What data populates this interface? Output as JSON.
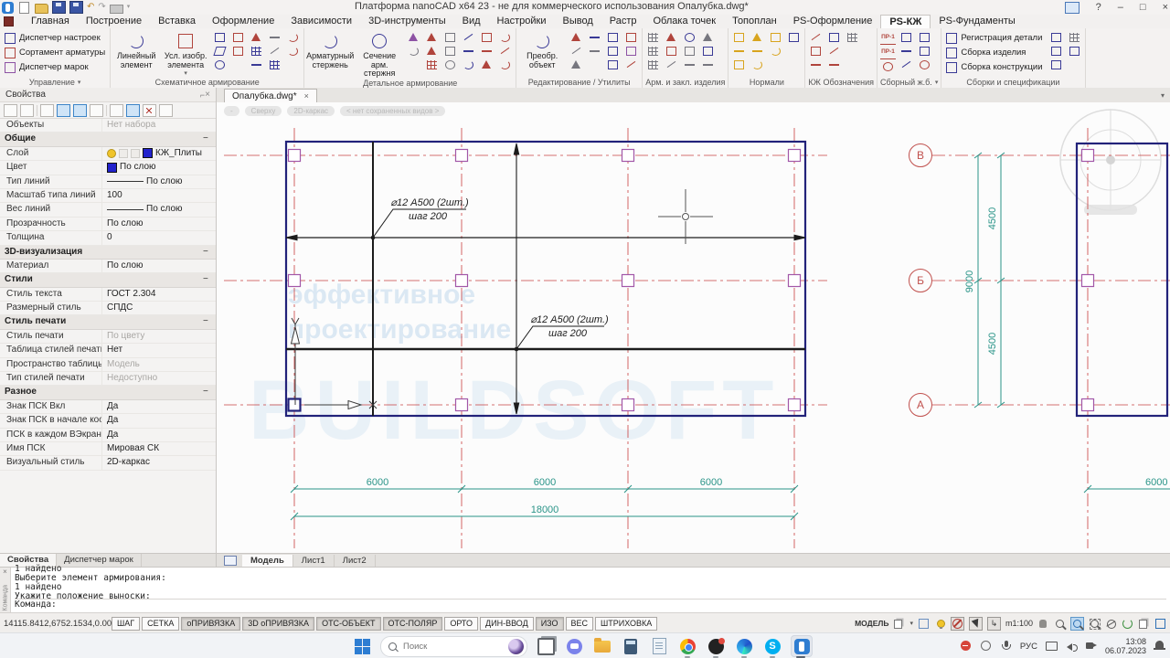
{
  "icons": {
    "close": "×",
    "dropdown": "▾",
    "help": "?",
    "minimize": "–",
    "maximize": "□",
    "undo": "↶",
    "redo": "↷",
    "collapse": "−",
    "more": "▾",
    "ucs": "↳"
  },
  "window": {
    "title": "Платформа nanoCAD x64 23 - не для коммерческого использования Опалубка.dwg*"
  },
  "menu": {
    "tabs": [
      "Главная",
      "Построение",
      "Вставка",
      "Оформление",
      "Зависимости",
      "3D-инструменты",
      "Вид",
      "Настройки",
      "Вывод",
      "Растр",
      "Облака точек",
      "Топоплан",
      "PS-Оформление",
      "PS-КЖ",
      "PS-Фундаменты"
    ],
    "active": "PS-КЖ"
  },
  "ribbon": {
    "groups": [
      {
        "label": "Управление",
        "arrow": true,
        "stack": [
          "Диспетчер настроек",
          "Сортамент арматуры",
          "Диспетчер марок"
        ],
        "stack_icons": [
          "n",
          "r",
          "v"
        ]
      },
      {
        "label": "Схематичное армирование",
        "big": [
          {
            "t": "Линейный элемент",
            "icon": "n-arc"
          },
          {
            "t": "Усл. изобр. элемента",
            "icon": "r-rect",
            "arrow": true
          }
        ],
        "cols": [
          [
            "n-rect",
            "n-para",
            "n-circ"
          ],
          [
            "r-rect",
            "r-rect"
          ],
          [
            "r-tri",
            "n-grid",
            "n-line"
          ],
          [
            "g-line",
            "g-diag",
            "n-grid"
          ],
          [
            "r-arc",
            "r-arc"
          ]
        ]
      },
      {
        "label": "Детальное армирование",
        "big": [
          {
            "t": "Арматурный стержень",
            "icon": "n-arc"
          },
          {
            "t": "Сечение арм. стержня",
            "icon": "n-circ"
          }
        ],
        "cols": [
          [
            "v-tri",
            "g-arc"
          ],
          [
            "r-tri",
            "r-tri",
            "r-grid"
          ],
          [
            "g-rect",
            "g-rect",
            "g-circ"
          ],
          [
            "n-diag",
            "n-line",
            "n-arc"
          ],
          [
            "r-rect",
            "r-line",
            "r-tri"
          ],
          [
            "r-arc",
            "r-diag",
            "r-arc"
          ]
        ]
      },
      {
        "label": "Редактирование / Утилиты",
        "big": [
          {
            "t": "Преобр. объект",
            "icon": "n-arc"
          }
        ],
        "cols": [
          [
            "r-tri",
            "g-diag",
            "g-tri"
          ],
          [
            "n-line",
            "g-line"
          ],
          [
            "n-rect",
            "n-rect",
            "n-rect"
          ],
          [
            "r-rect",
            "v-rect",
            "r-diag"
          ]
        ]
      },
      {
        "label": "Арм. и закл. изделия",
        "cols": [
          [
            "g-grid",
            "g-grid",
            "g-grid"
          ],
          [
            "r-tri",
            "r-rect",
            "g-diag"
          ],
          [
            "n-circ",
            "g-rect",
            "g-line"
          ],
          [
            "g-tri",
            "n-rect",
            "g-line"
          ]
        ]
      },
      {
        "label": "Нормали",
        "cols": [
          [
            "y-rect",
            "y-line",
            "y-rect"
          ],
          [
            "y-tri",
            "y-line",
            "y-arc"
          ],
          [
            "y-rect",
            "y-arc"
          ],
          [
            "n-rect"
          ]
        ]
      },
      {
        "label": "КЖ Обозначения",
        "cols": [
          [
            "r-diag",
            "r-rect",
            "r-line"
          ],
          [
            "n-rect",
            "r-diag",
            "r-line"
          ],
          [
            "g-grid"
          ]
        ]
      },
      {
        "label": "Сборный ж.б.",
        "arrow": true,
        "pr": "ПР-1",
        "cols": [
          [
            "pr",
            "pr",
            "r-circ"
          ],
          [
            "n-rect",
            "n-line",
            "n-diag"
          ],
          [
            "n-rect",
            "n-rect",
            "r-circ"
          ]
        ]
      },
      {
        "label": "Сборки и спецификации",
        "stack": [
          "Регистрация детали",
          "Сборка изделия",
          "Сборка конструкции"
        ],
        "stack_icons": [
          "n",
          "n",
          "n"
        ],
        "cols": [
          [
            "n-rect",
            "n-rect",
            "n-rect"
          ],
          [
            "g-grid",
            "n-rect"
          ]
        ]
      }
    ]
  },
  "properties_panel": {
    "title": "Свойства",
    "rows": [
      {
        "label": "Объекты",
        "value": "Нет набора",
        "muted": true
      },
      {
        "section": "Общие"
      },
      {
        "label": "Слой",
        "value": "КЖ_Плиты",
        "layer_icons": true,
        "swatch": "#2222cc"
      },
      {
        "label": "Цвет",
        "value": "По слою",
        "swatch": "#2222cc"
      },
      {
        "label": "Тип линий",
        "value": "По слою",
        "linesample": true
      },
      {
        "label": "Масштаб типа линий",
        "value": "100"
      },
      {
        "label": "Вес линий",
        "value": "По слою",
        "linesample": true
      },
      {
        "label": "Прозрачность",
        "value": "По слою"
      },
      {
        "label": "Толщина",
        "value": "0"
      },
      {
        "section": "3D-визуализация"
      },
      {
        "label": "Материал",
        "value": "По слою"
      },
      {
        "section": "Стили"
      },
      {
        "label": "Стиль текста",
        "value": "ГОСТ 2.304"
      },
      {
        "label": "Размерный стиль",
        "value": "СПДС"
      },
      {
        "section": "Стиль печати"
      },
      {
        "label": "Стиль печати",
        "value": "По цвету",
        "muted": true
      },
      {
        "label": "Таблица стилей печати",
        "value": "Нет"
      },
      {
        "label": "Пространство таблицы с...",
        "value": "Модель",
        "muted": true
      },
      {
        "label": "Тип стилей печати",
        "value": "Недоступно",
        "muted": true
      },
      {
        "section": "Разное"
      },
      {
        "label": "Знак ПСК Вкл",
        "value": "Да"
      },
      {
        "label": "Знак ПСК в начале коор...",
        "value": "Да"
      },
      {
        "label": "ПСК в каждом ВЭкране",
        "value": "Да"
      },
      {
        "label": "Имя ПСК",
        "value": "Мировая СК"
      },
      {
        "label": "Визуальный стиль",
        "value": "2D-каркас"
      }
    ],
    "tabs": [
      "Свойства",
      "Диспетчер марок"
    ],
    "active_tab": "Свойства"
  },
  "document": {
    "tab": "Опалубка.dwg*",
    "viewport_pills": [
      "-",
      "Сверху",
      "2D-каркас",
      "< нет сохраненных видов >"
    ]
  },
  "model_tabs": {
    "tabs": [
      "Модель",
      "Лист1",
      "Лист2"
    ],
    "active": "Модель"
  },
  "drawing": {
    "annotation1": {
      "l1": "⌀12 А500 (2шт.)",
      "l2": "шаг 200"
    },
    "annotation2": {
      "l1": "⌀12 А500 (2шт.)",
      "l2": "шаг 200"
    },
    "bottom_dims": [
      "6000",
      "6000",
      "6000"
    ],
    "total_dim": "18000",
    "right_dim": "6000",
    "vertical_dims": {
      "upper": "4500",
      "overall": "9000",
      "lower": "4500"
    },
    "grid_labels": [
      "В",
      "Б",
      "А"
    ],
    "watermark1": "эффективное",
    "watermark2": "проектирование",
    "watermark3": "BUILDSOFT"
  },
  "command_line": {
    "history": [
      "1 найдено",
      "Выберите элемент армирования:",
      "1 найдено",
      "Укажите положение выноски:"
    ],
    "prompt": "Команда:",
    "strip_label": "Команда"
  },
  "status_bar": {
    "coords": "14115.8412,6752.1534,0.0000",
    "toggles": [
      {
        "label": "ШАГ",
        "on": false
      },
      {
        "label": "СЕТКА",
        "on": false
      },
      {
        "label": "оПРИВЯЗКА",
        "on": true
      },
      {
        "label": "3D оПРИВЯЗКА",
        "on": true
      },
      {
        "label": "ОТС-ОБЪЕКТ",
        "on": true
      },
      {
        "label": "ОТС-ПОЛЯР",
        "on": true
      },
      {
        "label": "ОРТО",
        "on": false
      },
      {
        "label": "ДИН-ВВОД",
        "on": false
      },
      {
        "label": "ИЗО",
        "on": true
      },
      {
        "label": "ВЕС",
        "on": false
      },
      {
        "label": "ШТРИХОВКА",
        "on": false
      }
    ],
    "model_label": "МОДЕЛЬ",
    "scale": "m1:100"
  },
  "taskbar": {
    "search_placeholder": "Поиск",
    "skype_letter": "S",
    "tray": {
      "lang": "РУС",
      "time": "13:08",
      "date": "06.07.2023"
    }
  }
}
